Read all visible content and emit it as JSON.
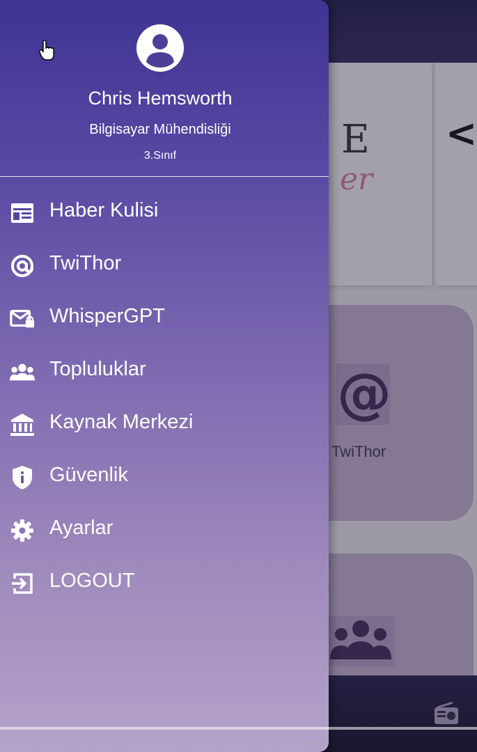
{
  "profile": {
    "name": "Chris Hemsworth",
    "department": "Bilgisayar Mühendisliği",
    "year": "3.Sınıf",
    "avatar_icon": "account-circle-icon"
  },
  "menu": {
    "items": [
      {
        "label": "Haber Kulisi",
        "icon": "newspaper-icon"
      },
      {
        "label": "TwiThor",
        "icon": "at-sign-icon"
      },
      {
        "label": "WhisperGPT",
        "icon": "mail-lock-icon"
      },
      {
        "label": "Topluluklar",
        "icon": "groups-icon"
      },
      {
        "label": "Kaynak Merkezi",
        "icon": "bank-icon"
      },
      {
        "label": "Güvenlik",
        "icon": "shield-info-icon"
      },
      {
        "label": "Ayarlar",
        "icon": "gear-icon"
      },
      {
        "label": "LOGOUT",
        "icon": "logout-icon"
      }
    ]
  },
  "background": {
    "banner_letter": "E",
    "banner_script": "er",
    "tile_label": "TwiThor",
    "chevron": "<"
  },
  "colors": {
    "drawer_top": "#3e3493",
    "drawer_bottom": "#b4a3c9",
    "text": "#ffffff"
  }
}
